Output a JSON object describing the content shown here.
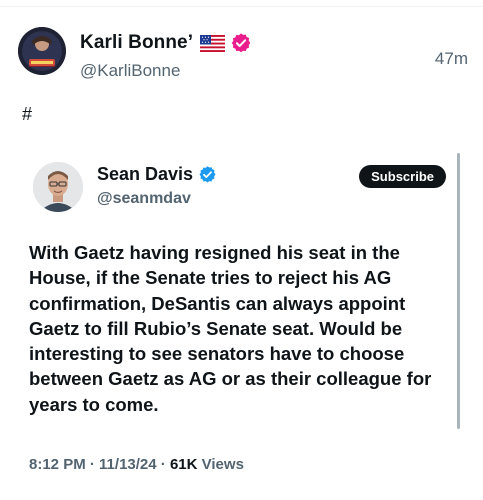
{
  "post": {
    "author_name": "Karli Bonne’",
    "author_handle": "@KarliBonne",
    "timestamp": "47m",
    "text": "#",
    "flag_icon": "us-flag-icon",
    "badge_icon": "verified-badge-icon",
    "badge_color": "#e91e8c"
  },
  "quote": {
    "author_name": "Sean Davis",
    "author_handle": "@seanmdav",
    "badge_icon": "verified-badge-icon",
    "badge_color": "#1d9bf0",
    "subscribe_label": "Subscribe",
    "body": "With Gaetz having resigned his seat in the House, if the Senate tries to reject his AG confirmation, DeSantis can always appoint Gaetz to fill Rubio’s Senate seat. Would be interesting to see senators have to choose between Gaetz as AG or as their colleague for years to come.",
    "time": "8:12 PM",
    "date": "11/13/24",
    "views_count": "61K",
    "views_label": "Views",
    "separator": "·"
  }
}
